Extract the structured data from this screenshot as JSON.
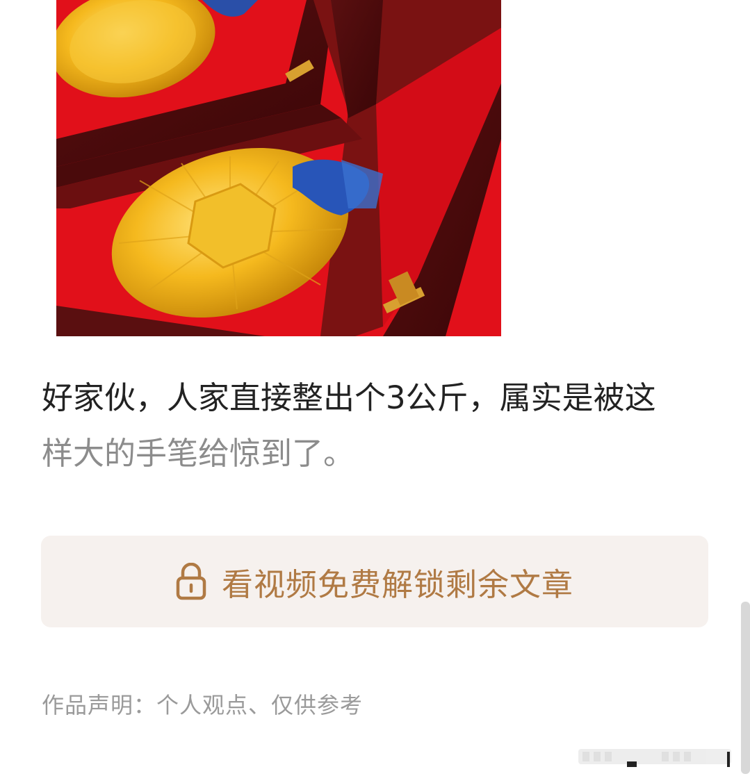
{
  "article": {
    "image_alt": "金牌",
    "line1": "好家伙，人家直接整出个3公斤，属实是被这",
    "line2": "样大的手笔给惊到了。"
  },
  "unlock_button": {
    "icon": "lock-icon",
    "label": "看视频免费解锁剩余文章",
    "color": "#b07a44",
    "background": "#f6f1ee"
  },
  "disclaimer": "作品声明：个人观点、仅供参考"
}
